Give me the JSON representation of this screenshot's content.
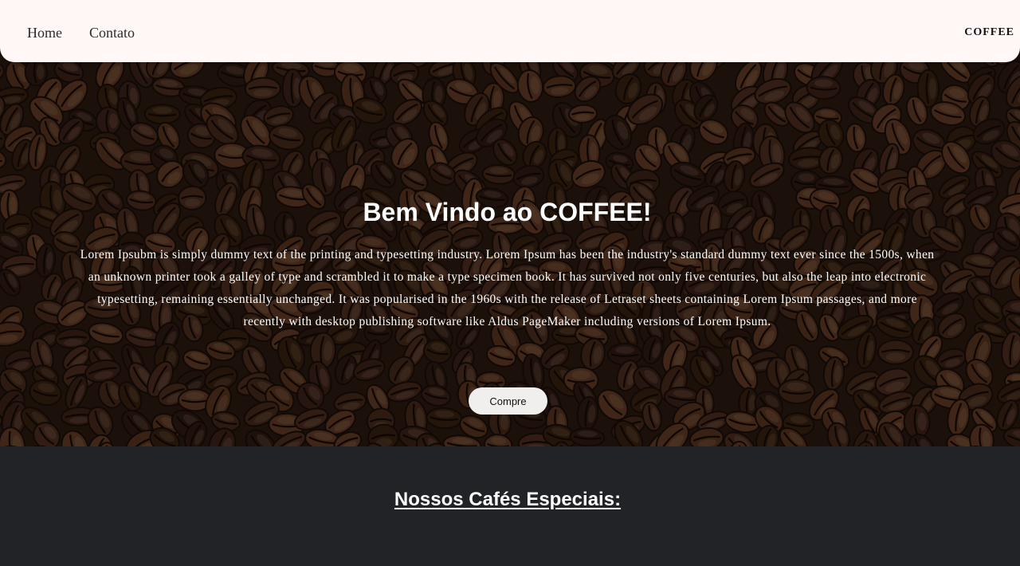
{
  "nav": {
    "links": [
      "Home",
      "Contato"
    ],
    "brand": "COFFEE",
    "background": "#fff8f7"
  },
  "hero": {
    "title": "Bem Vindo ao COFFEE!",
    "text": "Lorem Ipsubm is simply dummy text of the printing and typesetting industry. Lorem Ipsum has been the industry's standard dummy text ever since the 1500s, when an unknown printer took a galley of type and scrambled it to make a type specimen book. It has survived not only five centuries, but also the leap into electronic typesetting, remaining essentially unchanged. It was popularised in the 1960s with the release of Letraset sheets containing Lorem Ipsum passages, and more recently with desktop publishing software like Aldus PageMaker including versions of Lorem Ipsum.",
    "button_label": "Compre",
    "background_image": "coffee-beans-photo"
  },
  "specials": {
    "title": "Nossos Cafés Especiais:",
    "background": "#222327"
  }
}
